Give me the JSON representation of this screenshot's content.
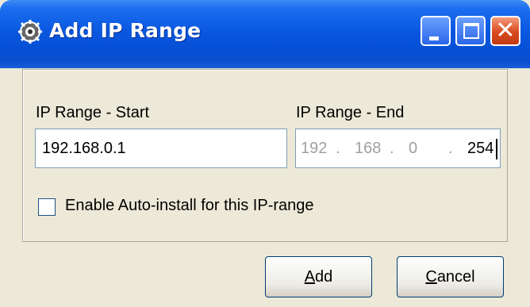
{
  "window": {
    "title": "Add IP Range",
    "close_glyph": "✕"
  },
  "form": {
    "start_label": "IP Range - Start",
    "start_value": "192.168.0.1",
    "end_label": "IP Range - End",
    "end_segments": [
      "192",
      ".",
      "168",
      ".",
      "0",
      ".",
      "254"
    ],
    "checkbox_label": "Enable Auto-install for this IP-range",
    "checkbox_checked": false
  },
  "buttons": {
    "add_accel": "A",
    "add_rest": "dd",
    "cancel_accel": "C",
    "cancel_rest": "ancel"
  },
  "colors": {
    "titlebar": "#0a58e0",
    "close_button": "#d84a1e",
    "dialog_bg": "#ece9d8"
  }
}
